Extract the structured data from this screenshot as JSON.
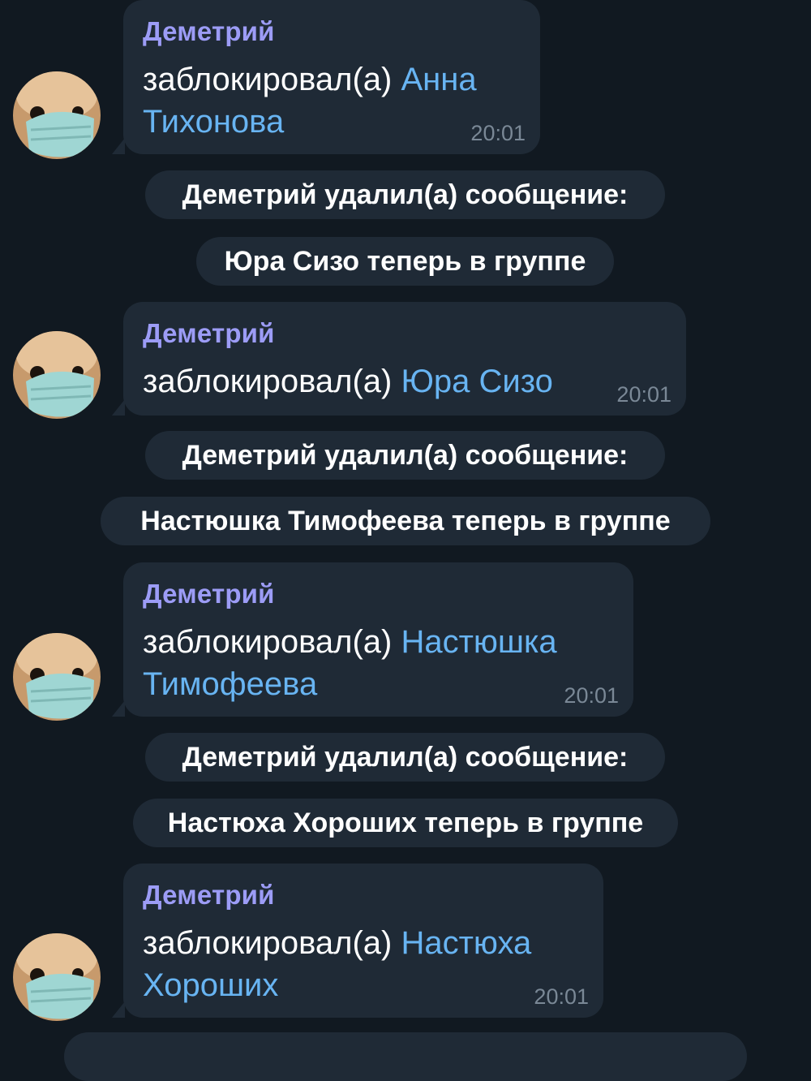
{
  "messages": [
    {
      "sender": "Деметрий",
      "action": "заблокировал(а)",
      "target_line1": "Анна",
      "target_line2": "Тихонова",
      "time": "20:01"
    },
    {
      "sender": "Деметрий",
      "action": "заблокировал(а)",
      "target_line1": "Юра Сизо",
      "time": "20:01"
    },
    {
      "sender": "Деметрий",
      "action": "заблокировал(а)",
      "target_line1": "Настюшка",
      "target_line2": "Тимофеева",
      "time": "20:01"
    },
    {
      "sender": "Деметрий",
      "action": "заблокировал(а)",
      "target_line1": "Настюха",
      "target_line2": "Хороших",
      "time": "20:01"
    }
  ],
  "service_messages": [
    "Деметрий удалил(а) сообщение:",
    "Юра Сизо теперь в группе",
    "Деметрий удалил(а) сообщение:",
    "Настюшка Тимофеева теперь в группе",
    "Деметрий удалил(а) сообщение:",
    "Настюха Хороших теперь в группе"
  ],
  "colors": {
    "background": "#111921",
    "bubble": "#1f2a36",
    "sender_name": "#9c9cf6",
    "link": "#68b4f2",
    "time": "#7a8896"
  },
  "icons": {
    "avatar": "cat-with-mask-avatar"
  }
}
